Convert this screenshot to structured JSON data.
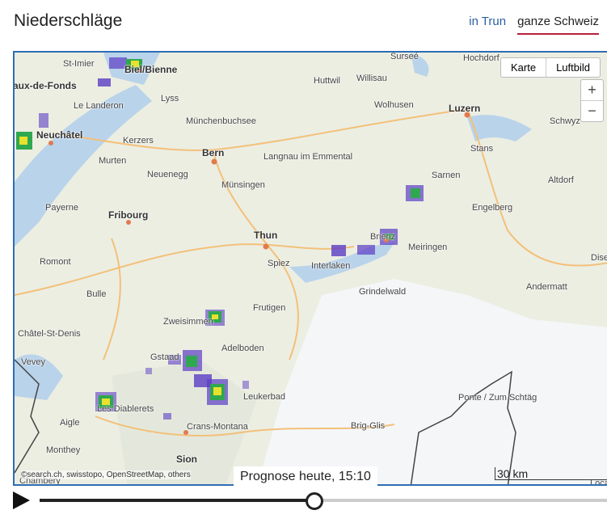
{
  "header": {
    "title": "Niederschläge",
    "tabs": [
      {
        "label": "in Trun",
        "active": false
      },
      {
        "label": "ganze Schweiz",
        "active": true
      }
    ]
  },
  "map": {
    "maptype_buttons": [
      "Karte",
      "Luftbild"
    ],
    "zoom": {
      "in": "+",
      "out": "−"
    },
    "attribution": "©search.ch, swisstopo, OpenStreetMap, others",
    "scale": "30 km",
    "places": [
      "St-Imier",
      "Biel/Bienne",
      "Surseé",
      "Hochdorf",
      "Huttwil",
      "Willisau",
      "Lyss",
      "aux-de-Fonds",
      "Le Landeron",
      "Wolhusen",
      "Luzern",
      "Münchenbuchsee",
      "Schwyz",
      "Neuchâtel",
      "Kerzers",
      "Bern",
      "Stans",
      "Murten",
      "Langnau im Emmental",
      "Neuenegg",
      "Sarnen",
      "Altdorf",
      "Payerne",
      "Münsingen",
      "Engelberg",
      "Fribourg",
      "Thun",
      "Brienz",
      "Meiringen",
      "Romont",
      "Spiez",
      "Interlaken",
      "Dise",
      "Bulle",
      "Grindelwald",
      "Andermatt",
      "Frutigen",
      "Châtel-St-Denis",
      "Zweisimmen",
      "Adelboden",
      "Gstaad",
      "Vevey",
      "Leukerbad",
      "Les Diablerets",
      "Ponte / Zum Schtäg",
      "Aigle",
      "Crans-Montana",
      "Brig-Glis",
      "Monthey",
      "Sion",
      "Chambery",
      "Loca"
    ],
    "precip_colors": [
      "#5b3cc4",
      "#2fa84f",
      "#e8e12e",
      "#e87a2e"
    ]
  },
  "player": {
    "time_label": "Prognose heute, 15:10",
    "progress_fraction": 0.485,
    "play_icon": "play-icon"
  }
}
